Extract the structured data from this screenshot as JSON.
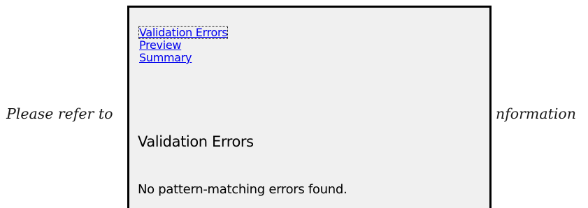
{
  "background_text": {
    "left": "Please refer to",
    "right": "nformation"
  },
  "popup": {
    "nav": {
      "validation_errors": "Validation Errors",
      "preview": "Preview",
      "summary": "Summary"
    },
    "section_title": "Validation Errors",
    "section_body": "No pattern-matching errors found."
  },
  "colors": {
    "link": "#0000ee",
    "popup_background": "#f0f0f0",
    "popup_border": "#000000"
  }
}
